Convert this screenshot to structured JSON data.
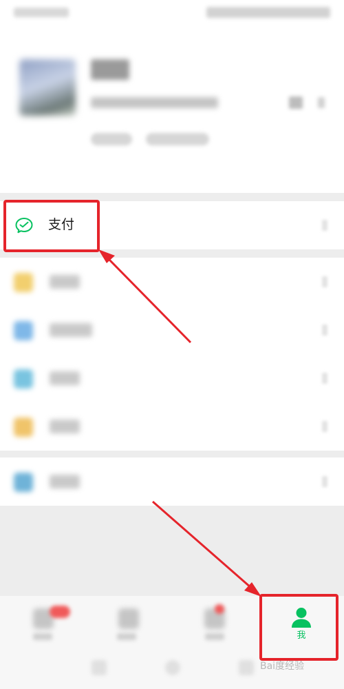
{
  "menu": {
    "pay": {
      "label": "支付",
      "icon": "wechat-pay-icon"
    }
  },
  "tab_bar": {
    "me": {
      "label": "我",
      "icon": "person-icon"
    }
  },
  "watermark": {
    "text": "Bai度经验"
  },
  "colors": {
    "accent": "#07c160",
    "annotation": "#e5242b",
    "background": "#ededed"
  }
}
